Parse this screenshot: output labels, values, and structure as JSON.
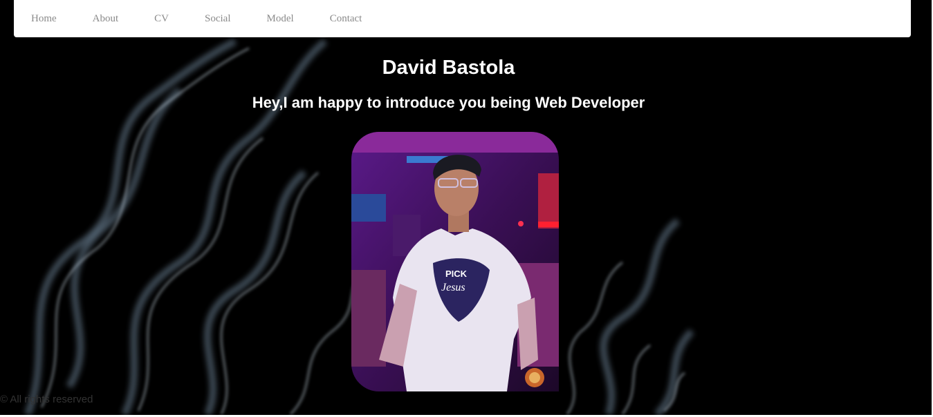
{
  "nav": {
    "items": [
      "Home",
      "About",
      "CV",
      "Social",
      "Model",
      "Contact"
    ]
  },
  "hero": {
    "name": "David Bastola",
    "tagline": "Hey,I am happy to introduce you being Web Developer",
    "shirt_text_1": "PICK",
    "shirt_text_2": "Jesus"
  },
  "footer": {
    "text": "© All rights reserved"
  }
}
